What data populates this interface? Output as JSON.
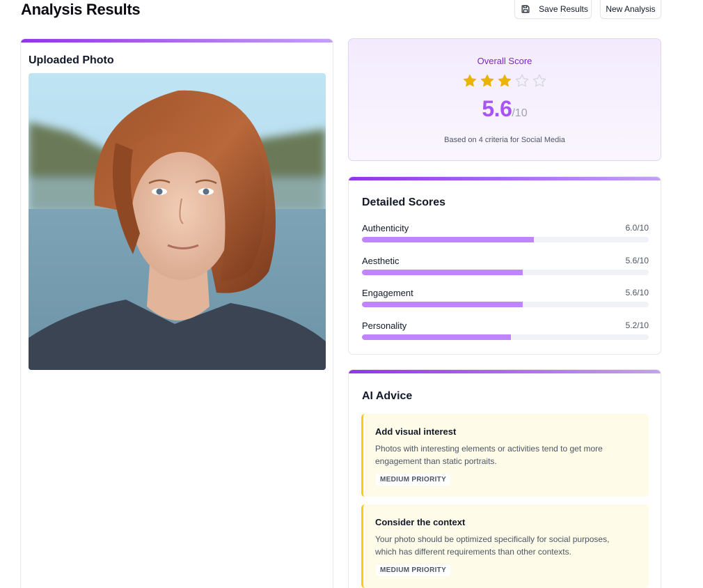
{
  "header": {
    "title": "Analysis Results",
    "save_label": "Save Results",
    "new_label": "New Analysis"
  },
  "photo": {
    "heading": "Uploaded Photo"
  },
  "overall": {
    "label": "Overall Score",
    "score": "5.6",
    "out_of": "/10",
    "stars_filled": 3,
    "stars_total": 5,
    "note": "Based on 4 criteria for Social Media"
  },
  "detailed": {
    "heading": "Detailed Scores",
    "items": [
      {
        "label": "Authenticity",
        "value": "6.0/10",
        "score": 6.0
      },
      {
        "label": "Aesthetic",
        "value": "5.6/10",
        "score": 5.6
      },
      {
        "label": "Engagement",
        "value": "5.6/10",
        "score": 5.6
      },
      {
        "label": "Personality",
        "value": "5.2/10",
        "score": 5.2
      }
    ]
  },
  "advice": {
    "heading": "AI Advice",
    "items": [
      {
        "title": "Add visual interest",
        "body": "Photos with interesting elements or activities tend to get more engagement than static portraits.",
        "priority": "MEDIUM PRIORITY"
      },
      {
        "title": "Consider the context",
        "body": "Your photo should be optimized specifically for social purposes, which has different requirements than other contexts.",
        "priority": "MEDIUM PRIORITY"
      }
    ]
  },
  "colors": {
    "accent": "#9333ea",
    "score_purple": "#a855f7",
    "bar_fill": "#c084fc",
    "star_gold": "#eab308",
    "advice_bg": "#fefbe8",
    "advice_border": "#facc15"
  },
  "icons": {
    "save": "save-icon",
    "star": "star-icon"
  }
}
